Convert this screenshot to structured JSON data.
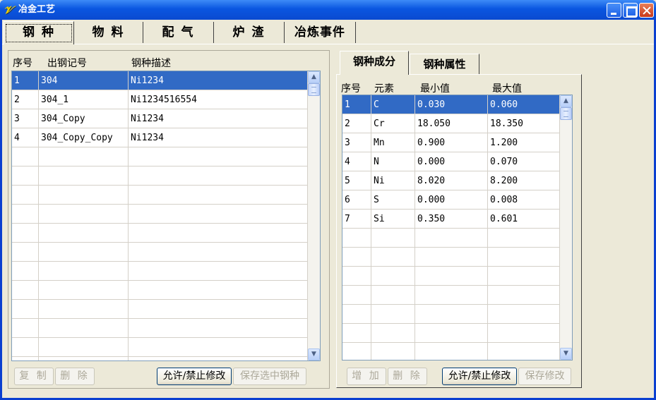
{
  "window": {
    "title": "冶金工艺",
    "app_icon": "𝒱"
  },
  "main_tabs": [
    {
      "label": "钢 种",
      "active": true
    },
    {
      "label": "物 料",
      "active": false
    },
    {
      "label": "配 气",
      "active": false
    },
    {
      "label": "炉 渣",
      "active": false
    },
    {
      "label": "冶炼事件",
      "active": false
    }
  ],
  "steel_table": {
    "headers": [
      "序号",
      "出钢记号",
      "钢种描述"
    ],
    "rows": [
      {
        "no": "1",
        "code": "304",
        "desc": "Ni1234",
        "selected": true
      },
      {
        "no": "2",
        "code": "304_1",
        "desc": "Ni1234516554",
        "selected": false
      },
      {
        "no": "3",
        "code": "304_Copy",
        "desc": "Ni1234",
        "selected": false
      },
      {
        "no": "4",
        "code": "304_Copy_Copy",
        "desc": "Ni1234",
        "selected": false
      }
    ],
    "buttons": {
      "copy": "复 制",
      "delete": "删 除",
      "toggle_edit": "允许/禁止修改",
      "save_selected": "保存选中钢种"
    }
  },
  "sub_tabs": [
    {
      "label": "钢种成分",
      "active": true
    },
    {
      "label": "钢种属性",
      "active": false
    }
  ],
  "composition_table": {
    "headers": [
      "序号",
      "元素",
      "最小值",
      "最大值"
    ],
    "rows": [
      {
        "no": "1",
        "element": "C",
        "min": "0.030",
        "max": "0.060",
        "selected": true
      },
      {
        "no": "2",
        "element": "Cr",
        "min": "18.050",
        "max": "18.350",
        "selected": false
      },
      {
        "no": "3",
        "element": "Mn",
        "min": "0.900",
        "max": "1.200",
        "selected": false
      },
      {
        "no": "4",
        "element": "N",
        "min": "0.000",
        "max": "0.070",
        "selected": false
      },
      {
        "no": "5",
        "element": "Ni",
        "min": "8.020",
        "max": "8.200",
        "selected": false
      },
      {
        "no": "6",
        "element": "S",
        "min": "0.000",
        "max": "0.008",
        "selected": false
      },
      {
        "no": "7",
        "element": "Si",
        "min": "0.350",
        "max": "0.601",
        "selected": false
      }
    ],
    "buttons": {
      "add": "增 加",
      "delete": "删 除",
      "toggle_edit": "允许/禁止修改",
      "save_edit": "保存修改"
    }
  },
  "colors": {
    "selection": "#316ac5",
    "titlebar": "#0a56e0",
    "face": "#ece9d8"
  }
}
